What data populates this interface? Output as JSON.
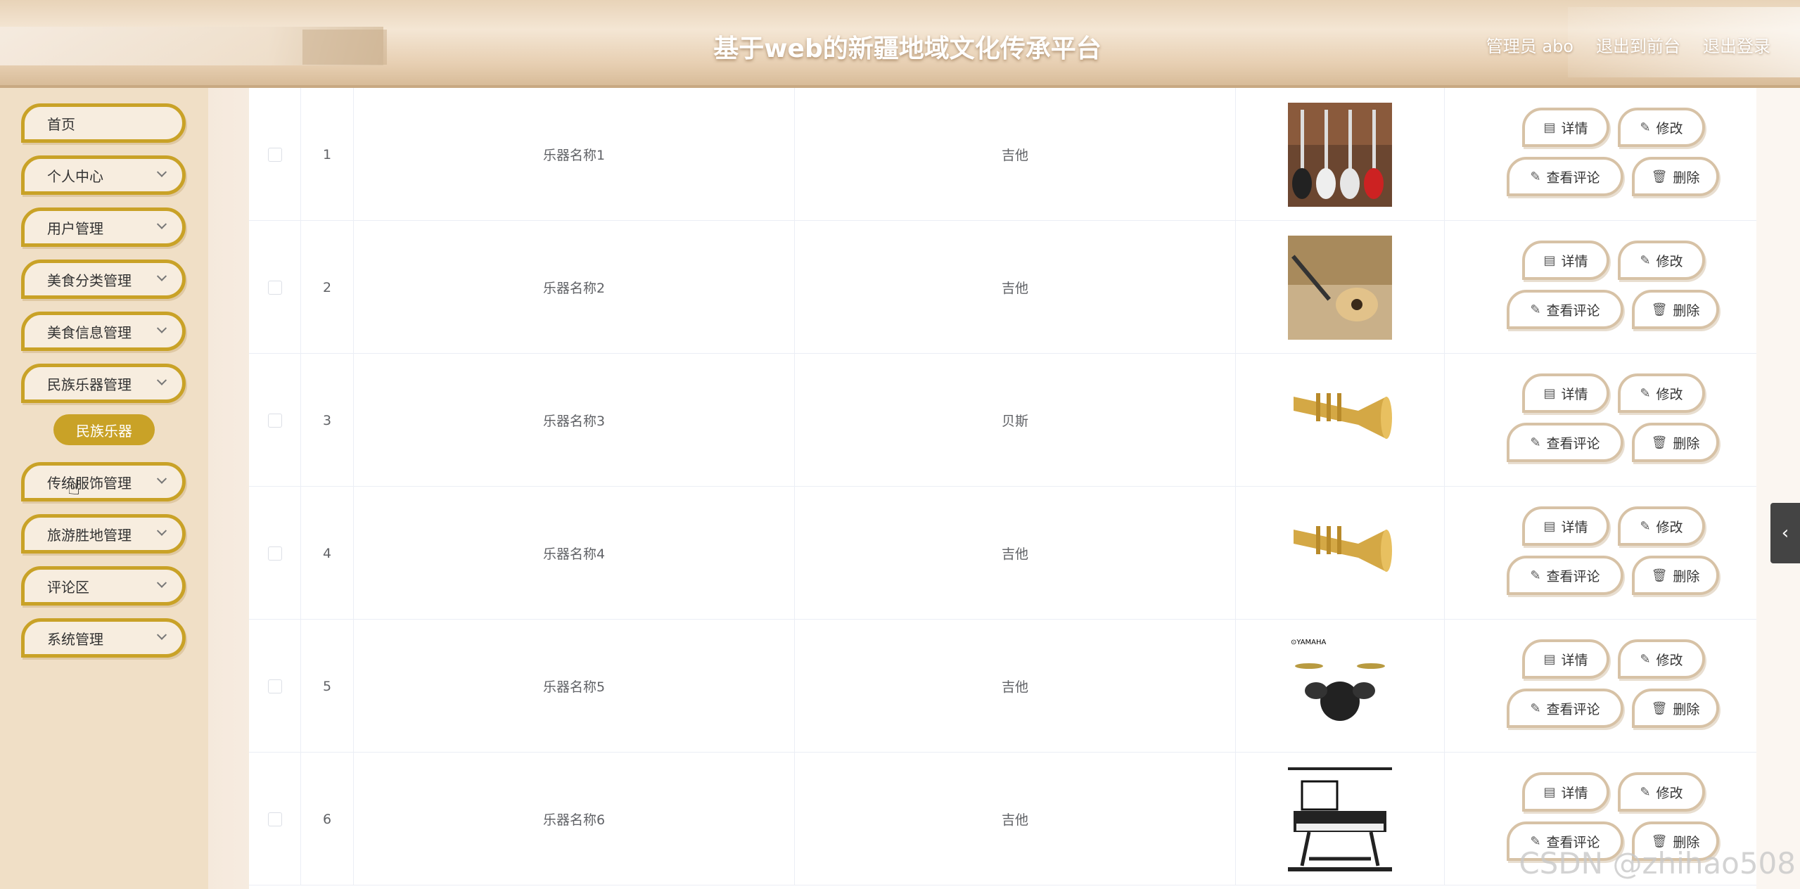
{
  "header": {
    "title": "基于web的新疆地域文化传承平台",
    "user_label": "管理员 abo",
    "front_link": "退出到前台",
    "logout_link": "退出登录"
  },
  "sidebar": {
    "items": [
      {
        "label": "首页",
        "has_submenu": false
      },
      {
        "label": "个人中心",
        "has_submenu": true
      },
      {
        "label": "用户管理",
        "has_submenu": true
      },
      {
        "label": "美食分类管理",
        "has_submenu": true
      },
      {
        "label": "美食信息管理",
        "has_submenu": true
      },
      {
        "label": "民族乐器管理",
        "has_submenu": true
      },
      {
        "label": "传统服饰管理",
        "has_submenu": true
      },
      {
        "label": "旅游胜地管理",
        "has_submenu": true
      },
      {
        "label": "评论区",
        "has_submenu": true
      },
      {
        "label": "系统管理",
        "has_submenu": true
      }
    ],
    "active_sub_item": "民族乐器"
  },
  "table": {
    "rows": [
      {
        "index": "1",
        "name": "乐器名称1",
        "type": "吉他",
        "image": "bass-guitars"
      },
      {
        "index": "2",
        "name": "乐器名称2",
        "type": "吉他",
        "image": "acoustic-guitar"
      },
      {
        "index": "3",
        "name": "乐器名称3",
        "type": "贝斯",
        "image": "trumpet"
      },
      {
        "index": "4",
        "name": "乐器名称4",
        "type": "吉他",
        "image": "trumpet"
      },
      {
        "index": "5",
        "name": "乐器名称5",
        "type": "吉他",
        "image": "drum-kit"
      },
      {
        "index": "6",
        "name": "乐器名称6",
        "type": "吉他",
        "image": "keyboard"
      }
    ],
    "actions": {
      "detail": "详情",
      "edit": "修改",
      "comment": "查看评论",
      "delete": "删除"
    }
  },
  "watermark": "CSDN @zhihao508",
  "colors": {
    "accent": "#c9a227",
    "button_border": "#d7c2a6",
    "sidebar_bg": "#f0dfc6"
  }
}
